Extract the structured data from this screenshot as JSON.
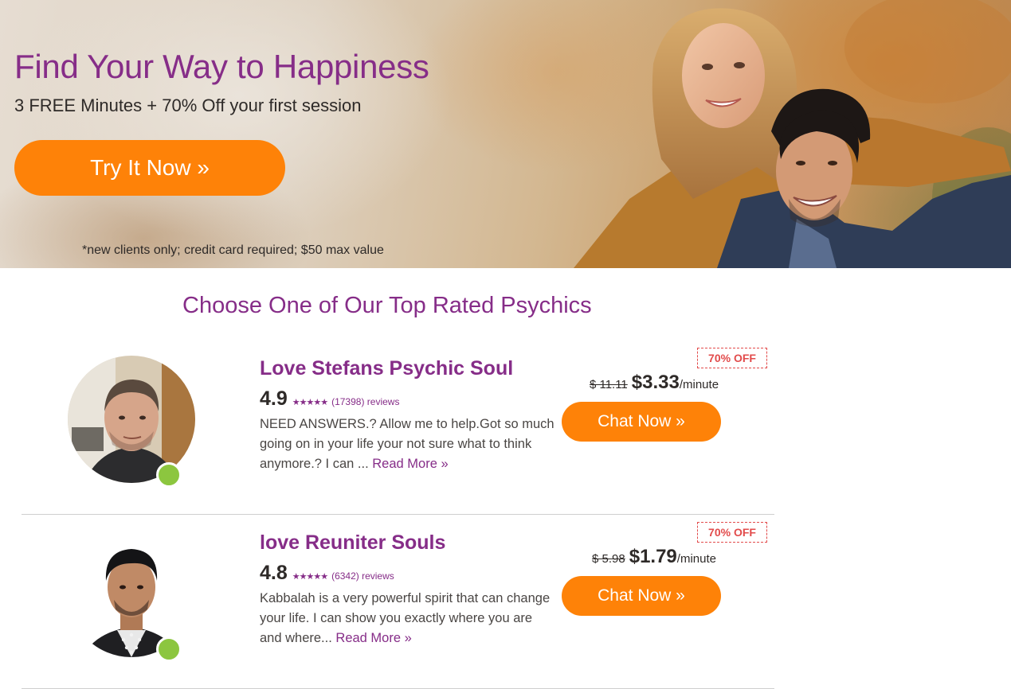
{
  "hero": {
    "title": "Find Your Way to Happiness",
    "subtitle": "3 FREE Minutes + 70% Off your first session",
    "cta_label": "Try It Now »",
    "disclaimer": "*new clients only; credit card required; $50 max value"
  },
  "section": {
    "title": "Choose One of Our Top Rated Psychics"
  },
  "psychics": [
    {
      "name": "Love Stefans Psychic Soul",
      "rating": "4.9",
      "stars": "★★★★★",
      "reviews": "(17398) reviews",
      "bio": "NEED ANSWERS.? Allow me to help.Got so much going on in your life your not sure what to think anymore.? I can ...",
      "read_more": "Read More »",
      "badge": "70% OFF",
      "old_price": "$ 11.11",
      "price": "$3.33",
      "per_minute": "/minute",
      "chat_label": "Chat Now »",
      "status": "online"
    },
    {
      "name": "love Reuniter Souls",
      "rating": "4.8",
      "stars": "★★★★★",
      "reviews": "(6342) reviews",
      "bio": "Kabbalah is a very powerful spirit that can change your life.  I can show you exactly where you are and where...",
      "read_more": "Read More »",
      "badge": "70% OFF",
      "old_price": "$ 5.98",
      "price": "$1.79",
      "per_minute": "/minute",
      "chat_label": "Chat Now »",
      "status": "online"
    }
  ],
  "colors": {
    "brand_purple": "#862d88",
    "cta_orange": "#fe8208",
    "online_green": "#8cc63f",
    "badge_red": "#e24b4b"
  }
}
